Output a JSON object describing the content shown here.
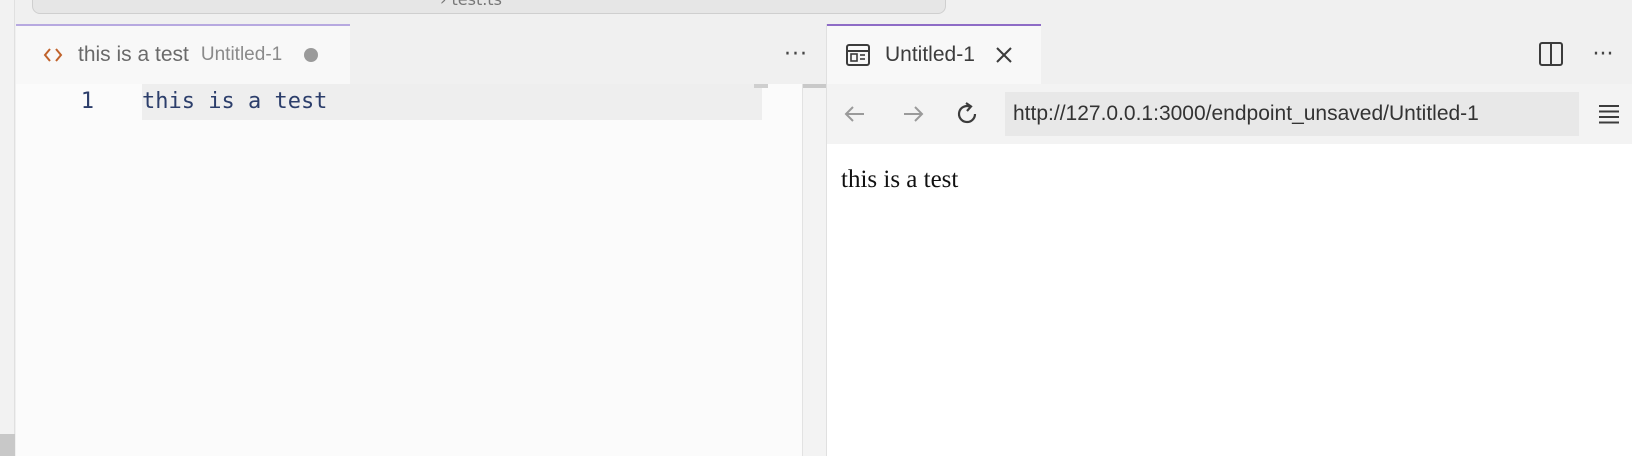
{
  "command_center": {
    "text": "› test.ts"
  },
  "left_editor": {
    "tab": {
      "title": "this is a test",
      "description": "Untitled-1",
      "icon": "html-code-icon",
      "icon_color": "#c0622b",
      "dirty": true
    },
    "more_actions": "···",
    "lines": [
      {
        "number": "1",
        "text": "this is a test"
      }
    ]
  },
  "right_editor": {
    "tab": {
      "title": "Untitled-1",
      "icon": "browser-preview-icon",
      "accent_color": "#8e6cc6"
    },
    "more_actions": "···",
    "browser": {
      "url": "http://127.0.0.1:3000/endpoint_unsaved/Untitled-1",
      "page_text": "this is a test"
    }
  }
}
